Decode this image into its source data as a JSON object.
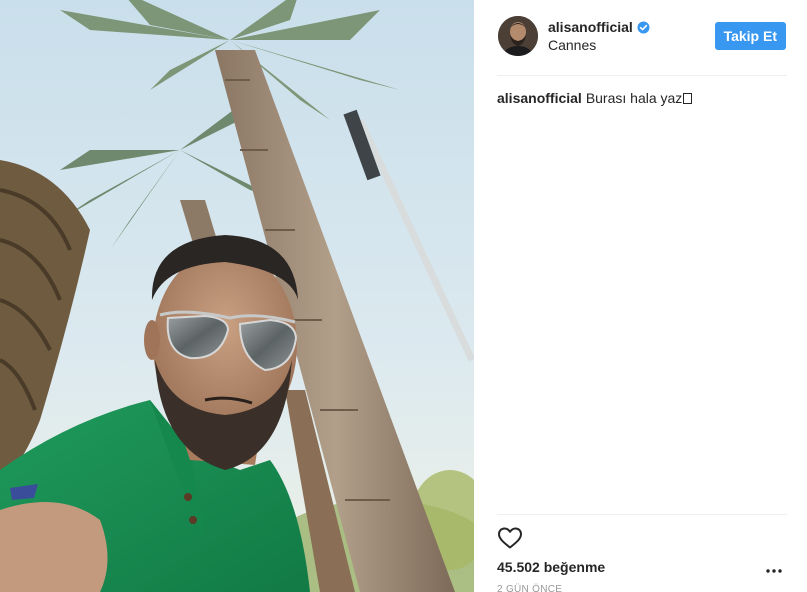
{
  "post": {
    "username": "alisanofficial",
    "location": "Cannes",
    "follow_label": "Takip Et",
    "caption_user": "alisanofficial",
    "caption_text": "Burası hala yaz",
    "likes": "45.502 beğenme",
    "timestamp": "2 GÜN ÖNCE"
  },
  "colors": {
    "follow_button": "#3897f0",
    "verified_badge": "#3897f0",
    "text": "#262626",
    "muted": "#999999"
  },
  "icons": {
    "verified": "verified-badge-icon",
    "like": "heart-outline-icon",
    "more": "more-options-icon"
  }
}
